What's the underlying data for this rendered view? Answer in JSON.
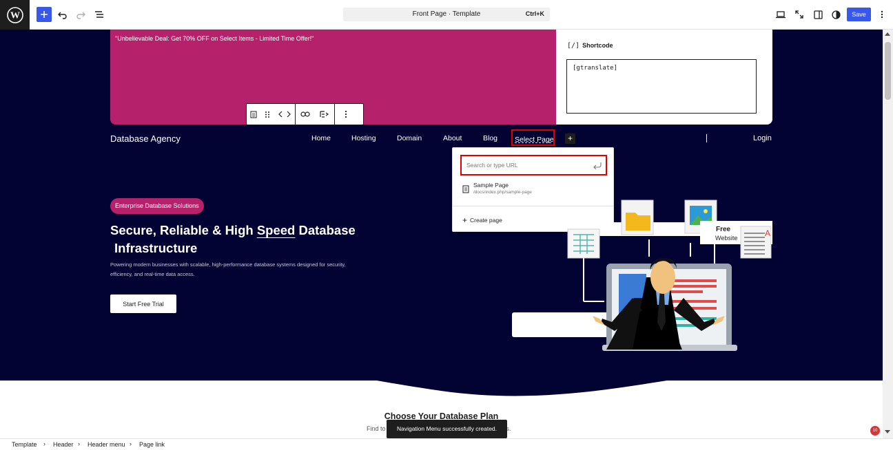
{
  "toolbar": {
    "document_title": "Front Page · Template",
    "shortcut": "Ctrl+K",
    "save_label": "Save"
  },
  "promo": {
    "text": "\"Unbelievable Deal: Get 70% OFF on Select Items - Limited Time Offer!\""
  },
  "shortcode": {
    "icon": "[/]",
    "title": "Shortcode",
    "value": "[gtranslate]"
  },
  "header": {
    "brand": "Database Agency",
    "nav": [
      "Home",
      "Hosting",
      "Domain",
      "About",
      "Blog"
    ],
    "selected_link": "Select Page",
    "login": "Login"
  },
  "link_popover": {
    "placeholder": "Search or type URL",
    "suggestion_title": "Sample Page",
    "suggestion_url": "/docs/index.php/sample-page",
    "create_label": "Create page"
  },
  "hero": {
    "badge": "Enterprise Database Solutions",
    "headline_pre": "Secure, Reliable & High",
    "headline_highlight": "Speed",
    "headline_post": "Database",
    "headline_line2": "Infrastructure",
    "subtext": "Powering modern businesses with scalable, high-performance database systems designed for security, efficiency, and real-time data access.",
    "cta": "Start Free Trial"
  },
  "illustration": {
    "free": "Free",
    "website": "Website"
  },
  "plans": {
    "title": "Choose Your Database Plan",
    "sub_left": "Find to",
    "sub_right": "ws."
  },
  "snackbar": "Navigation Menu successfully created.",
  "notifications": "10",
  "breadcrumb": [
    "Template",
    "Header",
    "Header menu",
    "Page link"
  ],
  "colors": {
    "accent": "#3858e9",
    "hero_bg": "#030333",
    "promo": "#b5216b",
    "highlight_border": "#e00000"
  }
}
